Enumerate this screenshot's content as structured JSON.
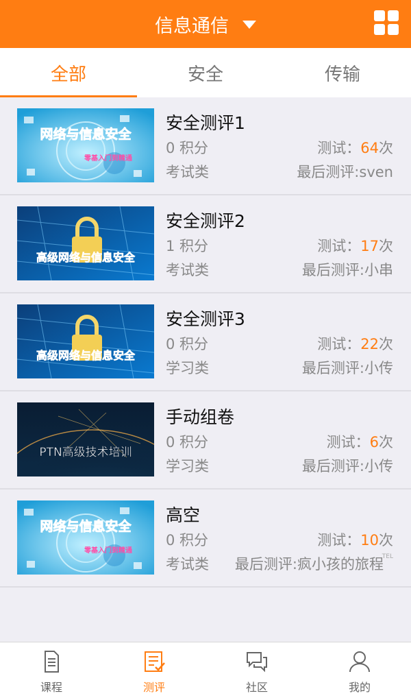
{
  "header": {
    "title": "信息通信"
  },
  "tabs": [
    {
      "label": "全部",
      "active": true
    },
    {
      "label": "安全",
      "active": false
    },
    {
      "label": "传输",
      "active": false
    }
  ],
  "items": [
    {
      "name": "安全测评1",
      "points": "0 积分",
      "tests_prefix": "测试：",
      "tests_count": "64",
      "tests_suffix": "次",
      "category": "考试类",
      "last": "最后测评:sven",
      "thumb": "网络与信息安全",
      "thumb_sub": "零基入门到精通"
    },
    {
      "name": "安全测评2",
      "points": "1 积分",
      "tests_prefix": "测试：",
      "tests_count": "17",
      "tests_suffix": "次",
      "category": "考试类",
      "last": "最后测评:小串",
      "thumb": "高级网络与信息安全"
    },
    {
      "name": "安全测评3",
      "points": "0 积分",
      "tests_prefix": "测试：",
      "tests_count": "22",
      "tests_suffix": "次",
      "category": "学习类",
      "last": "最后测评:小传",
      "thumb": "高级网络与信息安全"
    },
    {
      "name": "手动组卷",
      "points": "0 积分",
      "tests_prefix": "测试：",
      "tests_count": "6",
      "tests_suffix": "次",
      "category": "学习类",
      "last": "最后测评:小传",
      "thumb": "PTN高级技术培训"
    },
    {
      "name": "高空",
      "points": "0 积分",
      "tests_prefix": "测试：",
      "tests_count": "10",
      "tests_suffix": "次",
      "category": "考试类",
      "last": "最后测评:疯小孩的旅程",
      "tel": "TEL",
      "thumb": "网络与信息安全",
      "thumb_sub": "零基入门到精通"
    }
  ],
  "bottom_nav": [
    {
      "label": "课程",
      "icon": "document-icon",
      "active": false
    },
    {
      "label": "测评",
      "icon": "checklist-icon",
      "active": true
    },
    {
      "label": "社区",
      "icon": "chat-icon",
      "active": false
    },
    {
      "label": "我的",
      "icon": "user-icon",
      "active": false
    }
  ],
  "colors": {
    "accent": "#ff7d12",
    "background": "#efeef4"
  }
}
